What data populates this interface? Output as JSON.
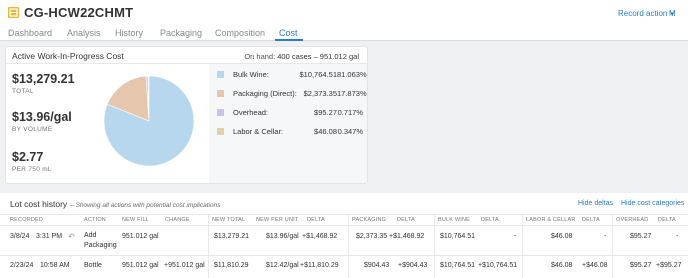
{
  "header": {
    "lot_code": "CG-HCW22CHMT",
    "record_action": "Record action",
    "more": "M"
  },
  "tabs": [
    {
      "label": "Dashboard"
    },
    {
      "label": "Analysis"
    },
    {
      "label": "History"
    },
    {
      "label": "Packaging"
    },
    {
      "label": "Composition"
    },
    {
      "label": "Cost"
    }
  ],
  "active_tab": "Cost",
  "wip": {
    "title": "Active Work-In-Progress Cost",
    "on_hand_label": "On hand:",
    "on_hand_value": "400 cases  –  951.012 gal",
    "total_value": "$13,279.21",
    "total_label": "TOTAL",
    "per_gal_value": "$13.96/gal",
    "per_gal_label": "BY VOLUME",
    "per_750_value": "$2.77",
    "per_750_label": "PER 750 mL",
    "breakdown": [
      {
        "name": "Bulk Wine:",
        "value": "$10,764.51",
        "percent": "81.063%",
        "fraction": 0.81063,
        "color": "#b6d7ee"
      },
      {
        "name": "Packaging (Direct):",
        "value": "$2,373.35",
        "percent": "17.873%",
        "fraction": 0.17873,
        "color": "#e6c7ae"
      },
      {
        "name": "Overhead:",
        "value": "$95.27",
        "percent": "0.717%",
        "fraction": 0.00717,
        "color": "#c9c3e8"
      },
      {
        "name": "Labor & Cellar:",
        "value": "$46.08",
        "percent": "0.347%",
        "fraction": 0.00347,
        "color": "#e3cfa5"
      }
    ]
  },
  "history": {
    "title": "Lot cost history",
    "subtitle": "– Showing all actions with potential cost implications",
    "hide_deltas": "Hide deltas",
    "hide_categories": "Hide cost categories",
    "columns": {
      "recorded": "RECORDED",
      "action": "ACTION",
      "new_fill": "NEW FILL",
      "change": "CHANGE",
      "new_total": "NEW TOTAL",
      "new_per_unit": "NEW PER UNIT",
      "delta": "DELTA",
      "packaging": "PACKAGING",
      "packaging_delta": "DELTA",
      "bulk_wine": "BULK WINE",
      "bulk_wine_delta": "DELTA",
      "labor": "LABOR & CELLAR",
      "labor_delta": "DELTA",
      "overhead": "OVERHEAD",
      "overhead_delta": "DELTA"
    },
    "rows": [
      {
        "date": "3/8/24",
        "time": "3:31 PM",
        "action_line1": "Add",
        "action_line2": "Packaging",
        "new_fill": "951.012 gal",
        "change": "",
        "new_total": "$13,279.21",
        "new_per_unit": "$13.96/gal",
        "delta": "+$1,468.92",
        "packaging": "$2,373.35",
        "packaging_delta": "+$1,468.92",
        "bulk_wine": "$10,764.51",
        "bulk_wine_delta": "-",
        "labor": "$46.08",
        "labor_delta": "-",
        "overhead": "$95.27",
        "overhead_delta": "-"
      },
      {
        "date": "2/23/24",
        "time": "10:58 AM",
        "action_line1": "Bottle",
        "action_line2": "",
        "new_fill": "951.012 gal",
        "change": "+951.012 gal",
        "new_total": "$11,810.29",
        "new_per_unit": "$12.42/gal",
        "delta": "+$11,810.29",
        "packaging": "$904.43",
        "packaging_delta": "+$904.43",
        "bulk_wine": "$10,764.51",
        "bulk_wine_delta": "+$10,764.51",
        "labor": "$46.08",
        "labor_delta": "+$46.08",
        "overhead": "$95.27",
        "overhead_delta": "+$95.27"
      }
    ]
  }
}
